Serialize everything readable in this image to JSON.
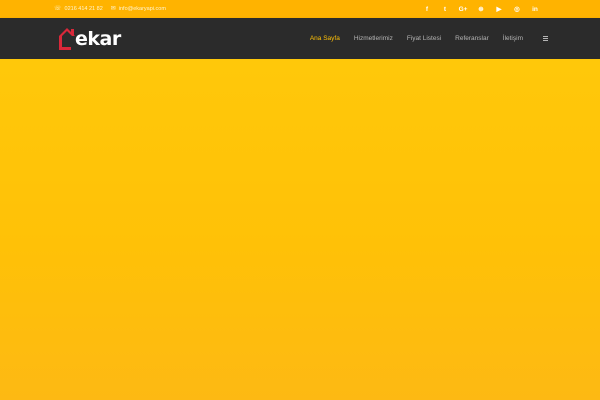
{
  "topbar": {
    "phone": "0216 414 21 82",
    "email": "info@ekaryapi.com",
    "social": [
      {
        "name": "facebook-icon",
        "glyph": "f"
      },
      {
        "name": "twitter-icon",
        "glyph": "t"
      },
      {
        "name": "google-plus-icon",
        "glyph": "G+"
      },
      {
        "name": "dribbble-icon",
        "glyph": "⊛"
      },
      {
        "name": "youtube-icon",
        "glyph": "▶"
      },
      {
        "name": "instagram-icon",
        "glyph": "◎"
      },
      {
        "name": "linkedin-icon",
        "glyph": "in"
      }
    ]
  },
  "logo": {
    "text": "ekar"
  },
  "nav": {
    "items": [
      {
        "label": "Ana Sayfa",
        "active": true
      },
      {
        "label": "Hizmetlerimiz",
        "active": false
      },
      {
        "label": "Fiyat Listesi",
        "active": false
      },
      {
        "label": "Referanslar",
        "active": false
      },
      {
        "label": "İletişim",
        "active": false
      }
    ]
  },
  "colors": {
    "accent": "#ffc107",
    "topbar": "#ffb300",
    "navbar": "#2b2b2b",
    "logo_red": "#d9283a"
  }
}
